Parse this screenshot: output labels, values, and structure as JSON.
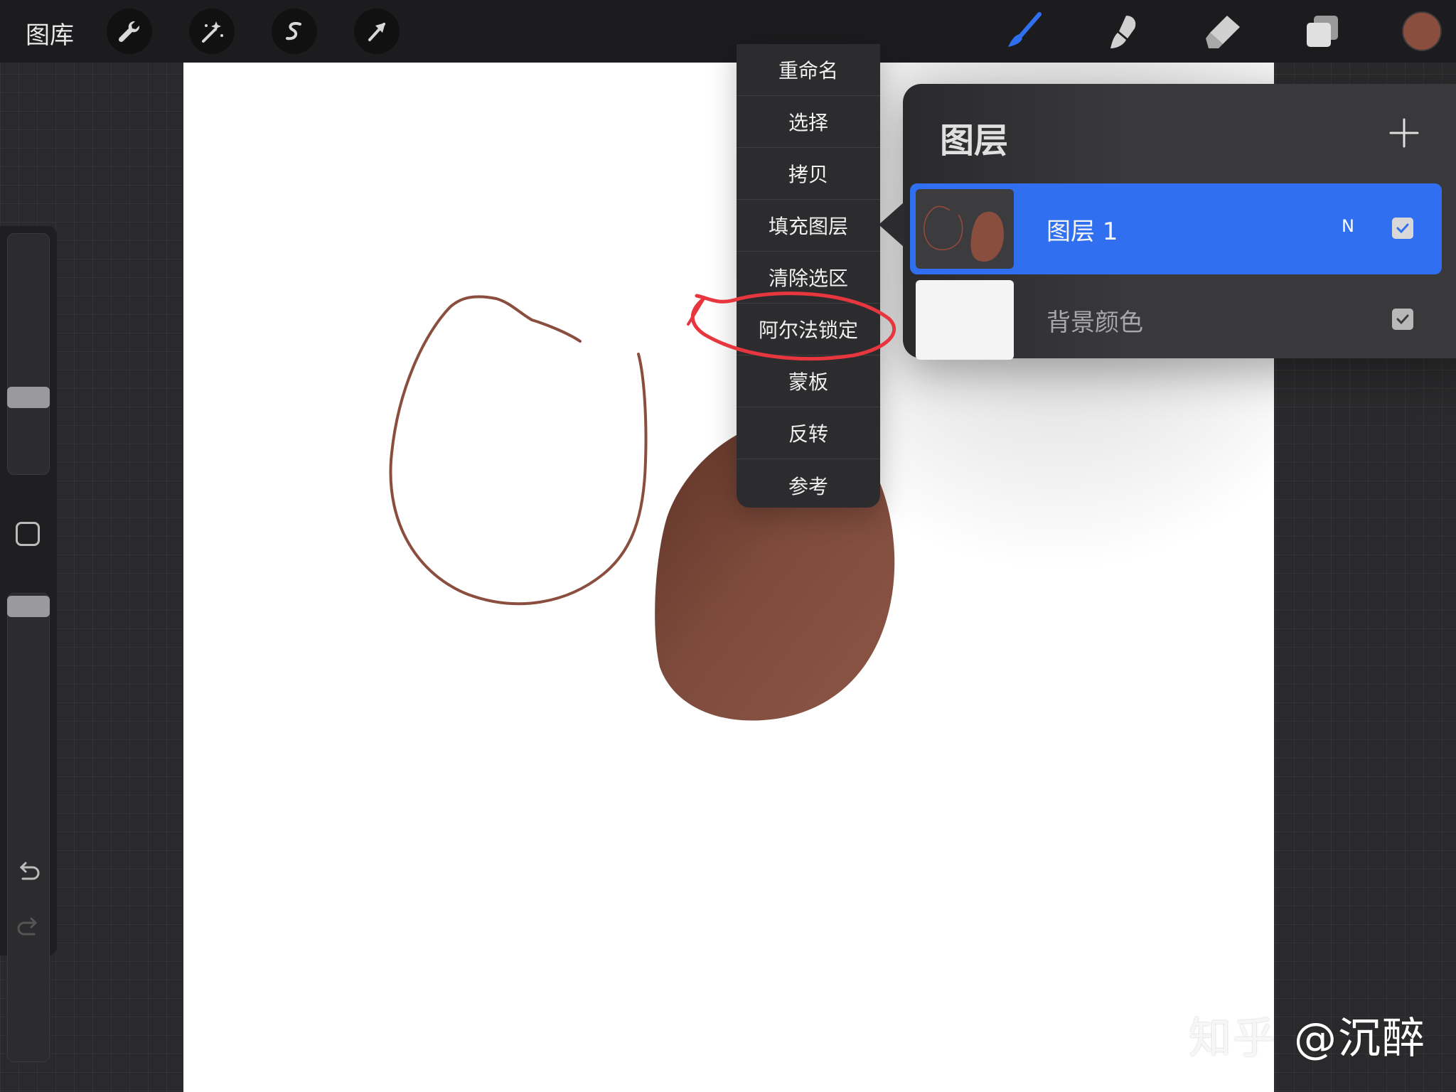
{
  "app": {
    "gallery_label": "图库"
  },
  "toolbar": {
    "left_tools": [
      {
        "icon": "wrench-icon",
        "name": "actions"
      },
      {
        "icon": "magic-wand-icon",
        "name": "adjustments"
      },
      {
        "icon": "selection-s-icon",
        "name": "selection"
      },
      {
        "icon": "arrow-transform-icon",
        "name": "transform"
      }
    ],
    "right_tools": [
      {
        "icon": "brush-icon",
        "name": "brush",
        "active": true
      },
      {
        "icon": "smudge-icon",
        "name": "smudge"
      },
      {
        "icon": "eraser-icon",
        "name": "eraser"
      },
      {
        "icon": "layers-icon",
        "name": "layers"
      }
    ],
    "current_color": "#8a4e3e",
    "active_color": "#2f6ff0"
  },
  "context_menu": {
    "items": [
      "重命名",
      "选择",
      "拷贝",
      "填充图层",
      "清除选区",
      "阿尔法锁定",
      "蒙板",
      "反转",
      "参考"
    ],
    "highlighted": "阿尔法锁定",
    "highlight_color": "#e8363f"
  },
  "layers_panel": {
    "title": "图层",
    "add_icon": "plus-icon",
    "layers": [
      {
        "name": "图层 1",
        "blend_mode": "N",
        "visible": true,
        "selected": true
      },
      {
        "name": "背景颜色",
        "blend_mode": "",
        "visible": true,
        "selected": false
      }
    ]
  },
  "sidebar": {
    "undo_icon": "undo-icon",
    "redo_icon": "redo-icon",
    "modify_icon": "square-modify-icon"
  },
  "canvas": {
    "stroke_color": "#8a4e3e",
    "fill_color": "#7f4a3c",
    "background": "#ffffff"
  },
  "watermark": {
    "brand": "知乎",
    "handle": "@沉醉"
  }
}
